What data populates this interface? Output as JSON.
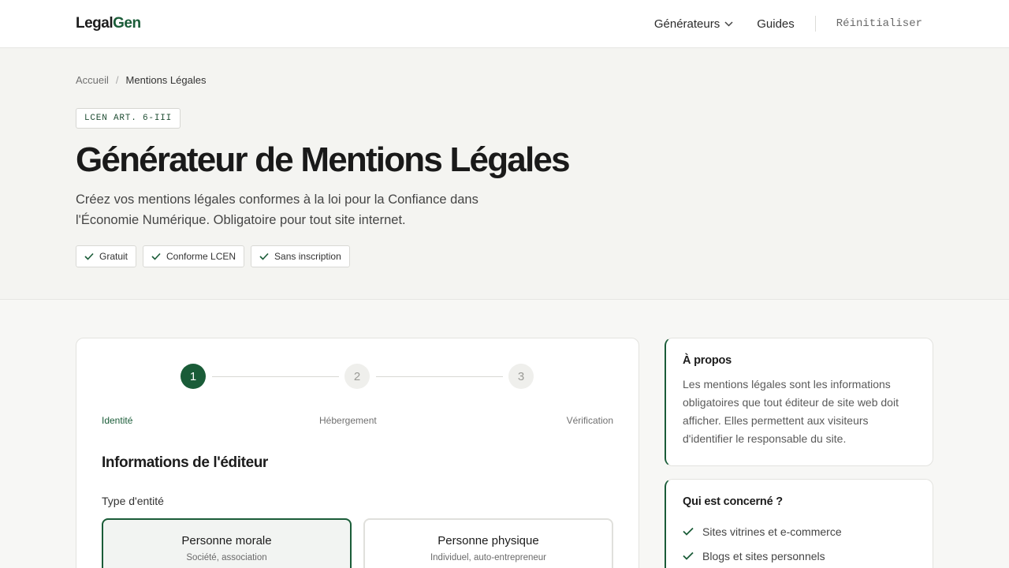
{
  "header": {
    "logo_part1": "Legal",
    "logo_part2": "Gen",
    "nav": {
      "generators": "Générateurs",
      "guides": "Guides",
      "reset": "Réinitialiser"
    }
  },
  "hero": {
    "breadcrumb": {
      "home": "Accueil",
      "separator": "/",
      "current": "Mentions Légales"
    },
    "tag": "LCEN ART. 6-III",
    "title": "Générateur de Mentions Légales",
    "subtitle": "Créez vos mentions légales conformes à la loi pour la Confiance dans l'Économie Numérique. Obligatoire pour tout site internet.",
    "badges": [
      "Gratuit",
      "Conforme LCEN",
      "Sans inscription"
    ]
  },
  "form": {
    "steps": [
      {
        "number": "1",
        "label": "Identité"
      },
      {
        "number": "2",
        "label": "Hébergement"
      },
      {
        "number": "3",
        "label": "Vérification"
      }
    ],
    "current_step": 1,
    "section_title": "Informations de l'éditeur",
    "entity_label": "Type d'entité",
    "entity_options": [
      {
        "title": "Personne morale",
        "desc": "Société, association",
        "selected": true
      },
      {
        "title": "Personne physique",
        "desc": "Individuel, auto-entrepreneur",
        "selected": false
      }
    ]
  },
  "sidebar": {
    "about": {
      "title": "À propos",
      "text": "Les mentions légales sont les informations obligatoires que tout éditeur de site web doit afficher. Elles permettent aux visiteurs d'identifier le responsable du site."
    },
    "who": {
      "title": "Qui est concerné ?",
      "items": [
        "Sites vitrines et e-commerce",
        "Blogs et sites personnels"
      ]
    }
  },
  "colors": {
    "accent": "#1a5c38",
    "background": "#f7f7f5",
    "text": "#1c1c1c"
  },
  "icons": {
    "nav_dropdown": "chevron-down-icon",
    "badge": "check-icon",
    "list": "check-icon"
  }
}
